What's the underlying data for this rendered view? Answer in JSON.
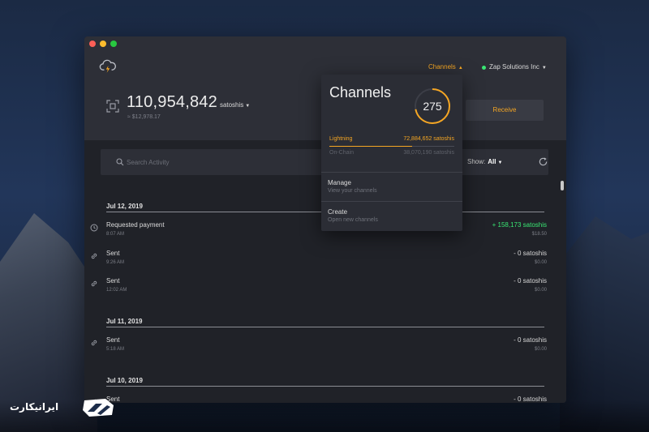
{
  "header": {
    "nav_channels": "Channels",
    "company": "Zap Solutions Inc",
    "balance": "110,954,842",
    "balance_unit": "satoshis",
    "fiat_balance": "≈ $12,978.17",
    "receive_label": "Receive"
  },
  "activity": {
    "search_placeholder": "Search Activity",
    "show_label": "Show:",
    "show_value": "All",
    "groups": [
      {
        "date": "Jul 12, 2019",
        "rows": [
          {
            "icon": "clock-icon",
            "title": "Requested payment",
            "time": "8:07 AM",
            "amount": "+ 158,173 satoshis",
            "fiat": "$18.50",
            "positive": true
          },
          {
            "icon": "link-icon",
            "title": "Sent",
            "time": "9:26 AM",
            "amount": "- 0 satoshis",
            "fiat": "$0.00",
            "positive": false
          },
          {
            "icon": "link-icon",
            "title": "Sent",
            "time": "12:02 AM",
            "amount": "- 0 satoshis",
            "fiat": "$0.00",
            "positive": false
          }
        ]
      },
      {
        "date": "Jul 11, 2019",
        "rows": [
          {
            "icon": "link-icon",
            "title": "Sent",
            "time": "5:18 AM",
            "amount": "- 0 satoshis",
            "fiat": "$0.00",
            "positive": false
          }
        ]
      },
      {
        "date": "Jul 10, 2019",
        "rows": [
          {
            "icon": "link-icon",
            "title": "Sent",
            "time": "",
            "amount": "- 0 satoshis",
            "fiat": "",
            "positive": false
          }
        ]
      }
    ]
  },
  "channels_panel": {
    "title": "Channels",
    "count": "275",
    "gauge_fraction": 0.72,
    "lightning_label": "Lightning",
    "lightning_value": "72,884,652 satoshis",
    "lightning_fraction": 0.66,
    "onchain_label": "On-Chain",
    "onchain_value": "38,070,190 satoshis",
    "manage_title": "Manage",
    "manage_sub": "View your channels",
    "create_title": "Create",
    "create_sub": "Open new channels"
  },
  "watermark": {
    "text": "ایرانیکارت"
  },
  "colors": {
    "accent": "#f5a623",
    "positive": "#39e673",
    "status_online": "#39e673"
  },
  "icons": [
    "cloud-lightning-icon",
    "qr-code-icon",
    "search-icon",
    "refresh-icon",
    "clock-icon",
    "link-icon",
    "chevron-down-icon",
    "chevron-up-icon"
  ]
}
